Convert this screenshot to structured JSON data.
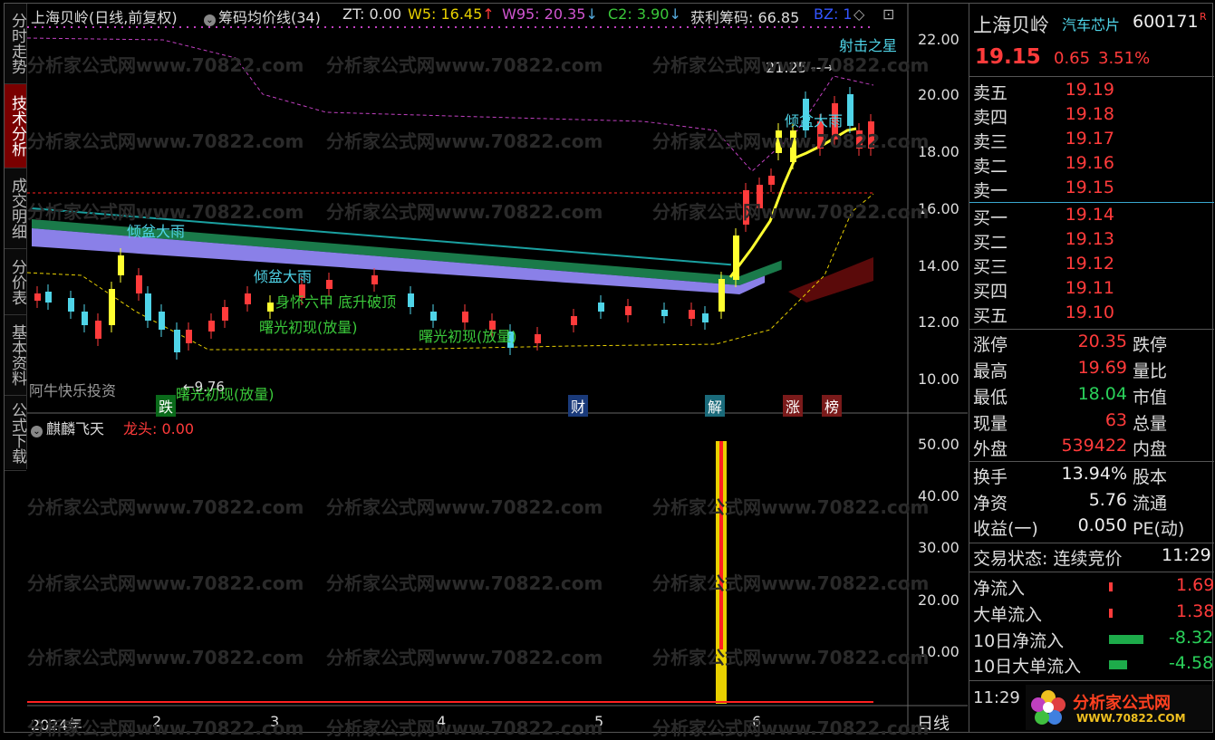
{
  "tabs": [
    "分时走势",
    "技术分析",
    "成交明细",
    "分价表",
    "基本资料",
    "公式下载"
  ],
  "header": {
    "stock": "上海贝岭",
    "period": "(日线,前复权)",
    "indicator": "筹码均价线(34)",
    "zt": "ZT: 0.00",
    "w5": "W5: 16.45",
    "w95": "W95: 20.35",
    "c2": "C2: 3.90",
    "profit": "获利筹码: 66.85",
    "bz": "BZ: 1"
  },
  "price_axis": [
    "22.00",
    "20.00",
    "18.00",
    "16.00",
    "14.00",
    "12.00",
    "10.00"
  ],
  "sub_axis": [
    "50.00",
    "40.00",
    "30.00",
    "20.00",
    "10.00"
  ],
  "x_axis": [
    "2024年",
    "2",
    "3",
    "4",
    "5",
    "6"
  ],
  "period_label": "日线",
  "annotations": {
    "qingpen1": "倾盆大雨",
    "qingpen2": "倾盆大雨",
    "qingpen3": "倾盆大雨",
    "shenhuai": "身怀六甲 底升破顶",
    "shuguang1": "曙光初现(放量)",
    "shuguang2": "曙光初现(放量)",
    "shuguang3": "曙光初现(放量)",
    "shejizhixing": "射击之星",
    "high_mark": "21.25",
    "low_mark": "9.76",
    "aniu": "阿牛快乐投资",
    "die": "跌",
    "cai": "财",
    "jie": "解",
    "zhang": "涨",
    "bang": "榜"
  },
  "sub_header": {
    "name": "麒麟飞天",
    "value": "龙头: 0.00"
  },
  "watermark": "分析家公式网www.70822.com",
  "quote": {
    "name": "上海贝岭",
    "sector": "汽车芯片",
    "code": "600171",
    "badge": "R",
    "price": "19.15",
    "change": "0.65",
    "pct": "3.51%",
    "asks": [
      {
        "label": "卖五",
        "price": "19.19"
      },
      {
        "label": "卖四",
        "price": "19.18"
      },
      {
        "label": "卖三",
        "price": "19.17"
      },
      {
        "label": "卖二",
        "price": "19.16"
      },
      {
        "label": "卖一",
        "price": "19.15"
      }
    ],
    "bids": [
      {
        "label": "买一",
        "price": "19.14"
      },
      {
        "label": "买二",
        "price": "19.13"
      },
      {
        "label": "买三",
        "price": "19.12"
      },
      {
        "label": "买四",
        "price": "19.11"
      },
      {
        "label": "买五",
        "price": "19.10"
      }
    ],
    "stats": [
      {
        "label": "涨停",
        "value": "20.35",
        "label2": "跌停",
        "color": "red"
      },
      {
        "label": "最高",
        "value": "19.69",
        "label2": "量比",
        "color": "red"
      },
      {
        "label": "最低",
        "value": "18.04",
        "label2": "市值",
        "color": "green"
      },
      {
        "label": "现量",
        "value": "63",
        "label2": "总量",
        "color": "red"
      },
      {
        "label": "外盘",
        "value": "539422",
        "label2": "内盘",
        "color": "red"
      }
    ],
    "fund": [
      {
        "label": "换手",
        "value": "13.94%",
        "label2": "股本"
      },
      {
        "label": "净资",
        "value": "5.76",
        "label2": "流通"
      },
      {
        "label": "收益(一)",
        "value": "0.050",
        "label2": "PE(动)"
      }
    ],
    "trade_status": "交易状态: 连续竞价",
    "trade_time": "11:29",
    "flows": [
      {
        "label": "净流入",
        "value": "1.69",
        "color": "red"
      },
      {
        "label": "大单流入",
        "value": "1.38",
        "color": "red"
      },
      {
        "label": "10日净流入",
        "value": "-8.32",
        "color": "green"
      },
      {
        "label": "10日大单流入",
        "value": "-4.58",
        "color": "green"
      }
    ],
    "time": "11:29",
    "logo": "分析家公式网",
    "logo_url": "WWW.70822.COM"
  }
}
